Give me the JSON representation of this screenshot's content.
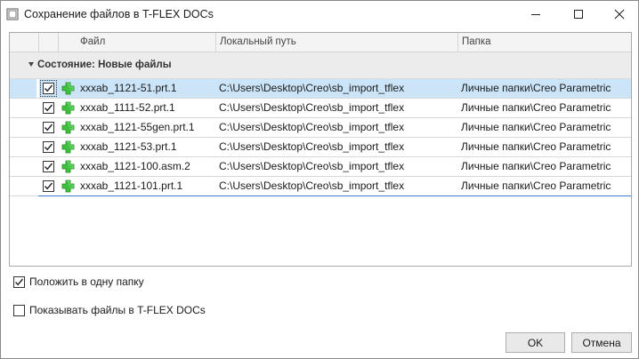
{
  "window": {
    "title": "Сохранение файлов в T-FLEX DOCs",
    "controls": {
      "minimize": "minimize-icon",
      "maximize": "maximize-icon",
      "close": "close-icon"
    }
  },
  "grid": {
    "columns": [
      "Файл",
      "Локальный путь",
      "Папка"
    ],
    "group": {
      "label": "Состояние: Новые файлы",
      "expanded": true
    },
    "rows": [
      {
        "checked": true,
        "file": "xxxab_1121-51.prt.1",
        "path": "C:\\Users\\Desktop\\Creo\\sb_import_tflex",
        "folder": "Личные папки\\Creo Parametric",
        "selected": true
      },
      {
        "checked": true,
        "file": "xxxab_1111-52.prt.1",
        "path": "C:\\Users\\Desktop\\Creo\\sb_import_tflex",
        "folder": "Личные папки\\Creo Parametric",
        "selected": false
      },
      {
        "checked": true,
        "file": "xxxab_1121-55gen.prt.1",
        "path": "C:\\Users\\Desktop\\Creo\\sb_import_tflex",
        "folder": "Личные папки\\Creo Parametric",
        "selected": false
      },
      {
        "checked": true,
        "file": "xxxab_1121-53.prt.1",
        "path": "C:\\Users\\Desktop\\Creo\\sb_import_tflex",
        "folder": "Личные папки\\Creo Parametric",
        "selected": false
      },
      {
        "checked": true,
        "file": "xxxab_1121-100.asm.2",
        "path": "C:\\Users\\Desktop\\Creo\\sb_import_tflex",
        "folder": "Личные папки\\Creo Parametric",
        "selected": false
      },
      {
        "checked": true,
        "file": "xxxab_1121-101.prt.1",
        "path": "C:\\Users\\Desktop\\Creo\\sb_import_tflex",
        "folder": "Личные папки\\Creo Parametric",
        "selected": false
      }
    ]
  },
  "options": {
    "same_folder": {
      "label": "Положить в одну папку",
      "checked": true
    },
    "show_in_docs": {
      "label": "Показывать файлы в T-FLEX DOCs",
      "checked": false
    }
  },
  "buttons": {
    "ok": "OK",
    "cancel": "Отмена"
  },
  "colors": {
    "selection": "#cce4f7",
    "add_icon": "#2fb52f",
    "focus_line": "#3a7bd5"
  }
}
